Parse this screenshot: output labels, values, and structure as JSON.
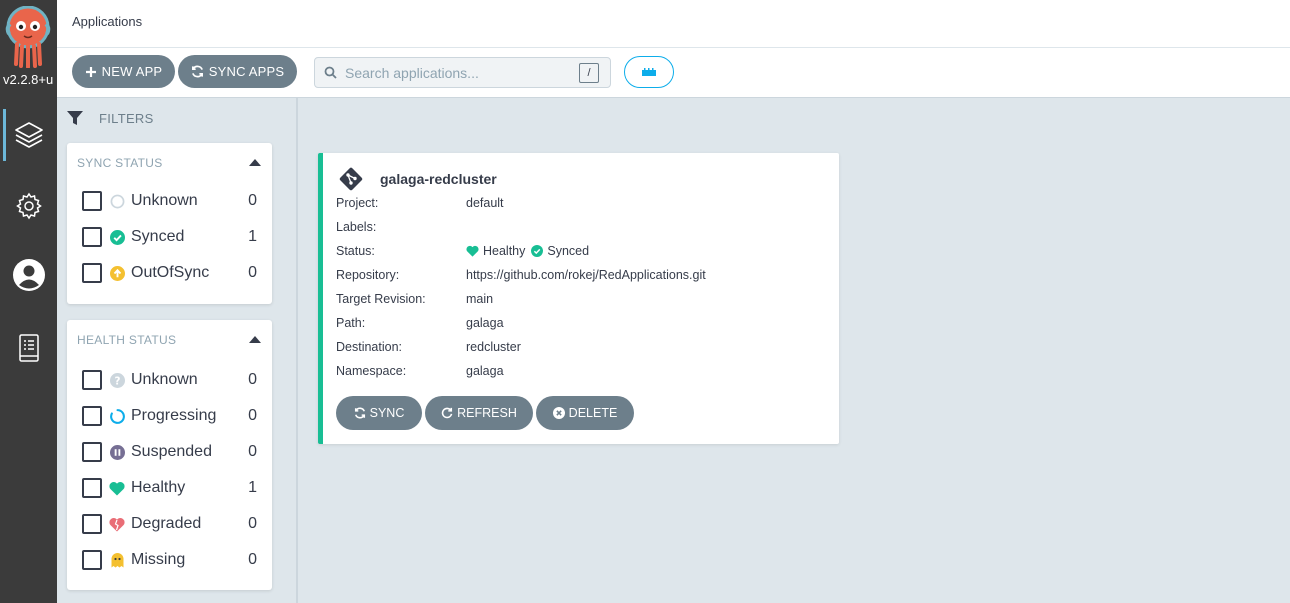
{
  "nav": {
    "version": "v2.2.8+u",
    "items": [
      {
        "name": "applications",
        "icon": "layers-icon",
        "active": true
      },
      {
        "name": "settings",
        "icon": "gear-icon",
        "active": false
      },
      {
        "name": "user-info",
        "icon": "user-icon",
        "active": false
      },
      {
        "name": "docs",
        "icon": "book-icon",
        "active": false
      }
    ]
  },
  "header": {
    "title": "Applications"
  },
  "toolbar": {
    "new_app_label": "NEW APP",
    "sync_apps_label": "SYNC APPS",
    "search_placeholder": "Search applications...",
    "search_shortcut": "/"
  },
  "filters": {
    "title": "FILTERS",
    "sync_status": {
      "title": "SYNC STATUS",
      "items": [
        {
          "label": "Unknown",
          "count": "0",
          "icon": "unknown-circle-icon"
        },
        {
          "label": "Synced",
          "count": "1",
          "icon": "check-circle-icon"
        },
        {
          "label": "OutOfSync",
          "count": "0",
          "icon": "arrow-up-circle-icon"
        }
      ]
    },
    "health_status": {
      "title": "HEALTH STATUS",
      "items": [
        {
          "label": "Unknown",
          "count": "0",
          "icon": "question-circle-icon"
        },
        {
          "label": "Progressing",
          "count": "0",
          "icon": "spinner-icon"
        },
        {
          "label": "Suspended",
          "count": "0",
          "icon": "pause-circle-icon"
        },
        {
          "label": "Healthy",
          "count": "1",
          "icon": "heart-icon"
        },
        {
          "label": "Degraded",
          "count": "0",
          "icon": "heart-broken-icon"
        },
        {
          "label": "Missing",
          "count": "0",
          "icon": "ghost-icon"
        }
      ]
    }
  },
  "app_card": {
    "name": "galaga-redcluster",
    "rows": [
      {
        "key": "Project:",
        "value": "default"
      },
      {
        "key": "Labels:",
        "value": ""
      },
      {
        "key": "Status:",
        "health": "Healthy",
        "sync": "Synced"
      },
      {
        "key": "Repository:",
        "value": "https://github.com/rokej/RedApplications.git"
      },
      {
        "key": "Target Revision:",
        "value": "main"
      },
      {
        "key": "Path:",
        "value": "galaga"
      },
      {
        "key": "Destination:",
        "value": "redcluster"
      },
      {
        "key": "Namespace:",
        "value": "galaga"
      }
    ],
    "actions": {
      "sync_label": "SYNC",
      "refresh_label": "REFRESH",
      "delete_label": "DELETE"
    }
  },
  "colors": {
    "nav_bg": "#3b3b3b",
    "accent": "#0dadea",
    "healthy": "#18be94",
    "out_of_sync": "#f4c030",
    "degraded": "#e96d76",
    "suspended": "#766f94",
    "button": "#6d7f8b"
  }
}
